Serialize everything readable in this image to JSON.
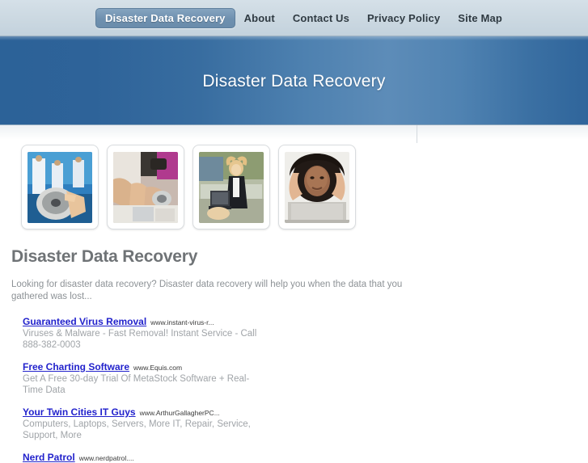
{
  "nav": {
    "items": [
      {
        "label": "Disaster Data Recovery",
        "active": true
      },
      {
        "label": "About",
        "active": false
      },
      {
        "label": "Contact Us",
        "active": false
      },
      {
        "label": "Privacy Policy",
        "active": false
      },
      {
        "label": "Site Map",
        "active": false
      }
    ]
  },
  "banner": {
    "title": "Disaster Data Recovery",
    "gradient_left": "#2c6298",
    "gradient_mid": "#5d8cb8",
    "gradient_right": "#2f659b"
  },
  "thumbnails": [
    {
      "name": "hard-drive-clean-room",
      "alt": "Technicians in a clean room handling an open hard drive"
    },
    {
      "name": "hard-drive-repair-hands",
      "alt": "Hands repairing an opened hard disk drive"
    },
    {
      "name": "frustrated-woman-laptop-outdoors",
      "alt": "Woman in a suit holding her head beside a laptop"
    },
    {
      "name": "stressed-woman-at-laptop",
      "alt": "Woman with hands on her head in front of a laptop"
    }
  ],
  "main": {
    "title": "Disaster Data Recovery",
    "intro": "Looking for disaster data recovery? Disaster data recovery will help you when the data that you gathered was lost..."
  },
  "ads": [
    {
      "title": "Guaranteed Virus Removal",
      "url": "www.instant-virus-r...",
      "description": "Viruses & Malware - Fast Removal! Instant Service - Call 888-382-0003"
    },
    {
      "title": "Free Charting Software",
      "url": "www.Equis.com",
      "description": "Get A Free 30-day Trial Of MetaStock Software + Real-Time Data"
    },
    {
      "title": "Your Twin Cities IT Guys",
      "url": "www.ArthurGallagherPC...",
      "description": "Computers, Laptops, Servers, More IT, Repair, Service, Support, More"
    },
    {
      "title": "Nerd Patrol",
      "url": "www.nerdpatrol....",
      "description": ""
    }
  ],
  "colors": {
    "nav_background": "#ccd9e2",
    "nav_active": "#6e90af",
    "link": "#2222cc",
    "body_text": "#a0a4a8",
    "heading": "#6f7376"
  }
}
